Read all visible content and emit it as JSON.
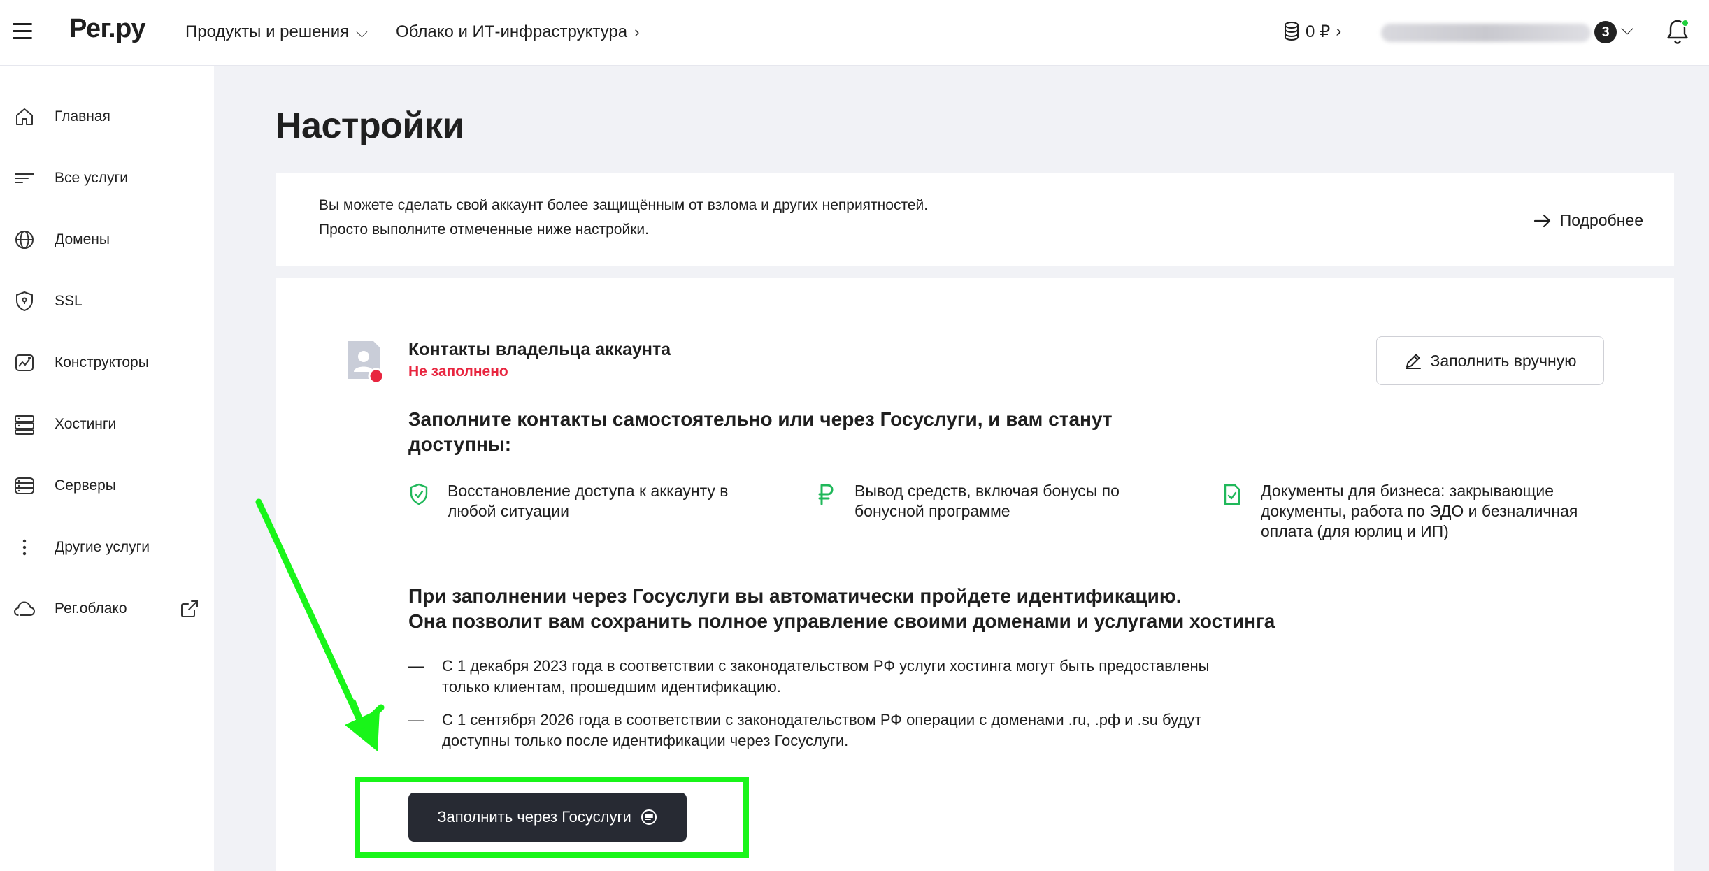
{
  "header": {
    "logo": "Рег.ру",
    "nav": [
      {
        "label": "Продукты и решения",
        "chevron": "⌵"
      },
      {
        "label": "Облако и ИТ-инфраструктура",
        "chevron": "›"
      }
    ],
    "balance": "0 ₽",
    "balance_chevron": "›",
    "notifications_count": "3",
    "account_chevron": "⌵"
  },
  "sidebar": {
    "items": [
      {
        "label": "Главная",
        "icon": "home-icon"
      },
      {
        "label": "Все услуги",
        "icon": "list-icon"
      },
      {
        "label": "Домены",
        "icon": "globe-icon"
      },
      {
        "label": "SSL",
        "icon": "shield-icon"
      },
      {
        "label": "Конструкторы",
        "icon": "constructor-icon"
      },
      {
        "label": "Хостинги",
        "icon": "hosting-icon"
      },
      {
        "label": "Серверы",
        "icon": "server-icon"
      },
      {
        "label": "Другие услуги",
        "icon": "more-vertical-icon"
      }
    ],
    "cloud": {
      "label": "Рег.облако",
      "icon": "cloud-icon"
    }
  },
  "page": {
    "title": "Настройки",
    "info": {
      "line1": "Вы можете сделать свой аккаунт более защищённым от взлома и других неприятностей.",
      "line2": "Просто выполните отмеченные ниже настройки.",
      "more_link": "Подробнее"
    },
    "owner": {
      "title": "Контакты владельца аккаунта",
      "status": "Не заполнено",
      "fill_manual_label": "Заполнить вручную",
      "lead": "Заполните контакты самостоятельно или через Госуслуги, и вам станут доступны:",
      "benefits": [
        "Восстановление доступа к аккаунту в любой ситуации",
        "Вывод средств, включая бонусы по бонусной программе",
        "Документы для бизнеса: закрывающие документы, работа по ЭДО и безналичная оплата (для юрлиц и ИП)"
      ],
      "gos_lead_1": "При заполнении через Госуслуги вы автоматически пройдете идентификацию.",
      "gos_lead_2": "Она позволит вам сохранить полное управление своими доменами и услугами хостинга",
      "rules": [
        "С 1 декабря 2023 года в соответствии с законодательством РФ услуги хостинга могут быть предоставлены только клиентам, прошедшим идентификацию.",
        "С 1 сентября 2026 года в соответствии с законодательством РФ операции с доменами .ru, .рф и .su будут доступны только после идентификации через Госуслуги."
      ],
      "rule_dash": "—",
      "gos_button_label": "Заполнить через Госуслуги"
    }
  },
  "colors": {
    "accent_green": "#19f519",
    "status_red": "#e8253f",
    "icon_green": "#20b85a",
    "dark_button": "#272a33"
  }
}
